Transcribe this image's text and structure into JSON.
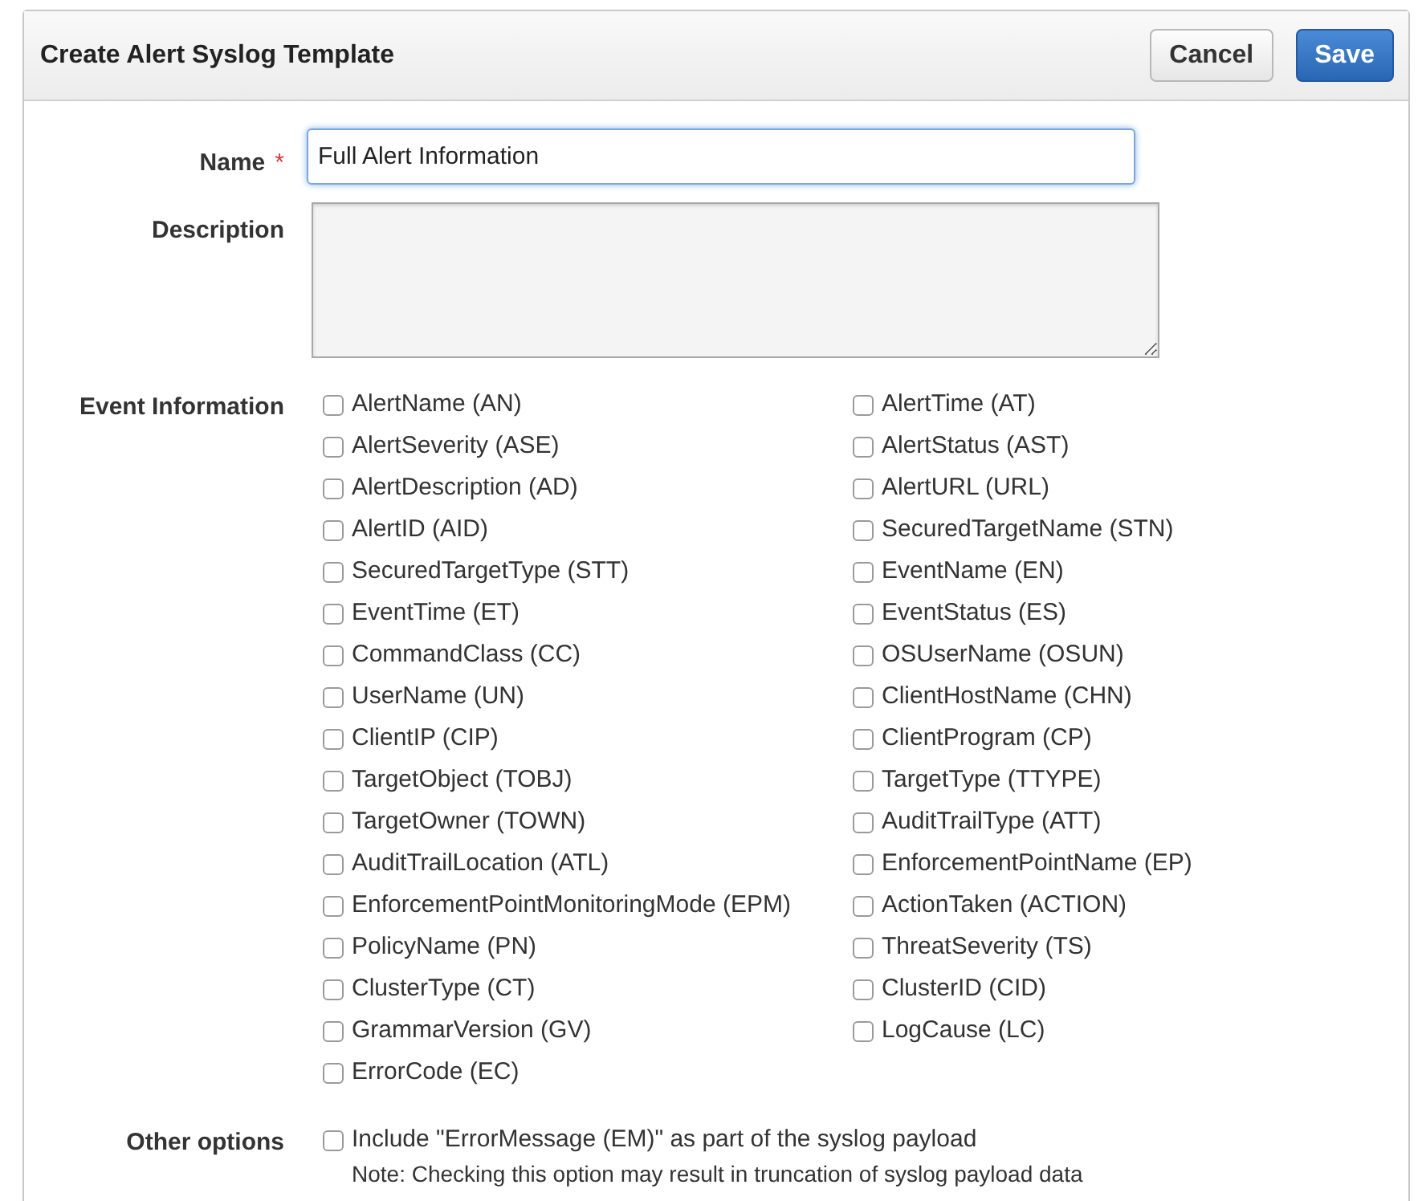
{
  "dialog": {
    "title": "Create Alert Syslog Template",
    "buttons": [
      {
        "label": "Cancel",
        "kind": "secondary"
      },
      {
        "label": "Save",
        "kind": "primary"
      }
    ]
  },
  "name_field": {
    "label": "Name",
    "required_mark": "*",
    "value": "Full Alert Information"
  },
  "description_field": {
    "label": "Description"
  },
  "event_information": {
    "label": "Event Information",
    "columns": [
      [
        {
          "label": "AlertName (AN)",
          "checked": false
        },
        {
          "label": "AlertSeverity (ASE)",
          "checked": false
        },
        {
          "label": "AlertDescription (AD)",
          "checked": false
        },
        {
          "label": "AlertID (AID)",
          "checked": false
        },
        {
          "label": "SecuredTargetType (STT)",
          "checked": false
        },
        {
          "label": "EventTime (ET)",
          "checked": false
        },
        {
          "label": "CommandClass (CC)",
          "checked": false
        },
        {
          "label": "UserName (UN)",
          "checked": false
        },
        {
          "label": "ClientIP (CIP)",
          "checked": false
        },
        {
          "label": "TargetObject (TOBJ)",
          "checked": false
        },
        {
          "label": "TargetOwner (TOWN)",
          "checked": false
        },
        {
          "label": "AuditTrailLocation (ATL)",
          "checked": false
        },
        {
          "label": "EnforcementPointMonitoringMode (EPM)",
          "checked": false
        },
        {
          "label": "PolicyName (PN)",
          "checked": false
        },
        {
          "label": "ClusterType (CT)",
          "checked": false
        },
        {
          "label": "GrammarVersion (GV)",
          "checked": false
        },
        {
          "label": "ErrorCode (EC)",
          "checked": false
        }
      ],
      [
        {
          "label": "AlertTime (AT)",
          "checked": false
        },
        {
          "label": "AlertStatus (AST)",
          "checked": false
        },
        {
          "label": "AlertURL (URL)",
          "checked": false
        },
        {
          "label": "SecuredTargetName (STN)",
          "checked": false
        },
        {
          "label": "EventName (EN)",
          "checked": false
        },
        {
          "label": "EventStatus (ES)",
          "checked": false
        },
        {
          "label": "OSUserName (OSUN)",
          "checked": false
        },
        {
          "label": "ClientHostName (CHN)",
          "checked": false
        },
        {
          "label": "ClientProgram (CP)",
          "checked": false
        },
        {
          "label": "TargetType (TTYPE)",
          "checked": false
        },
        {
          "label": "AuditTrailType (ATT)",
          "checked": false
        },
        {
          "label": "EnforcementPointName (EP)",
          "checked": false
        },
        {
          "label": "ActionTaken (ACTION)",
          "checked": false
        },
        {
          "label": "ThreatSeverity (TS)",
          "checked": false
        },
        {
          "label": "ClusterID (CID)",
          "checked": false
        },
        {
          "label": "LogCause (LC)",
          "checked": false
        }
      ]
    ]
  },
  "other_options": {
    "label": "Other options",
    "option": {
      "label": "Include \"ErrorMessage (EM)\" as part of the syslog payload",
      "checked": false
    },
    "note": "Note: Checking this option may result in truncation of syslog payload data"
  }
}
